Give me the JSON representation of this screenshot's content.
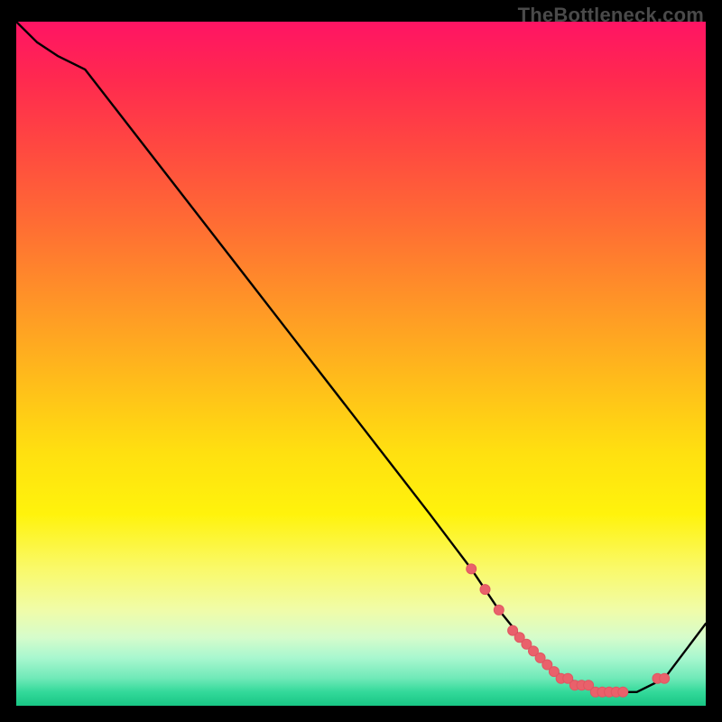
{
  "watermark": "TheBottleneck.com",
  "chart_data": {
    "type": "line",
    "title": "",
    "xlabel": "",
    "ylabel": "",
    "xlim": [
      0,
      100
    ],
    "ylim": [
      0,
      100
    ],
    "background": "rainbow-vertical",
    "series": [
      {
        "name": "curve",
        "x": [
          0,
          3,
          6,
          10,
          20,
          30,
          40,
          50,
          60,
          66,
          70,
          74,
          78,
          82,
          86,
          90,
          94,
          100
        ],
        "y": [
          100,
          97,
          95,
          93,
          80,
          67,
          54,
          41,
          28,
          20,
          14,
          9,
          5,
          3,
          2,
          2,
          4,
          12
        ]
      }
    ],
    "dots": {
      "name": "markers",
      "x": [
        66,
        68,
        70,
        72,
        73,
        74,
        75,
        76,
        77,
        78,
        79,
        80,
        81,
        82,
        83,
        84,
        85,
        86,
        87,
        88,
        93,
        94
      ],
      "y": [
        20,
        17,
        14,
        11,
        10,
        9,
        8,
        7,
        6,
        5,
        4,
        4,
        3,
        3,
        3,
        2,
        2,
        2,
        2,
        2,
        4,
        4
      ]
    }
  }
}
